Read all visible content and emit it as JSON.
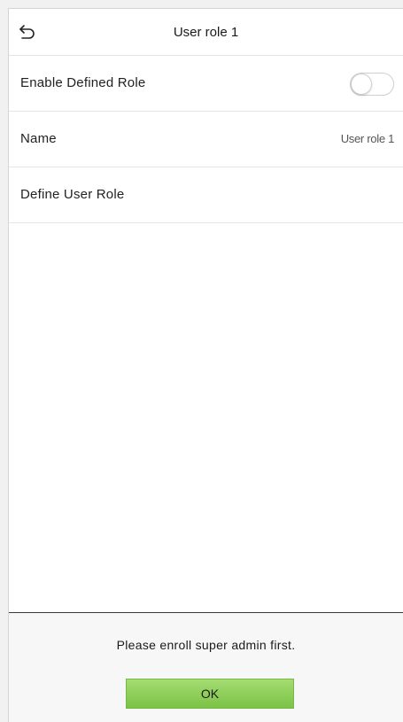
{
  "header": {
    "title": "User role 1",
    "back_icon": "back-arrow-icon"
  },
  "settings": {
    "enable_defined_role": {
      "label": "Enable Defined Role",
      "enabled": false
    },
    "name": {
      "label": "Name",
      "value": "User role 1"
    },
    "define_user_role": {
      "label": "Define User Role"
    }
  },
  "dialog": {
    "message": "Please enroll super admin first.",
    "ok_label": "OK"
  },
  "colors": {
    "ok_button": "#8ecf5a",
    "background": "#ffffff",
    "dialog_background": "#f7f7f7"
  }
}
